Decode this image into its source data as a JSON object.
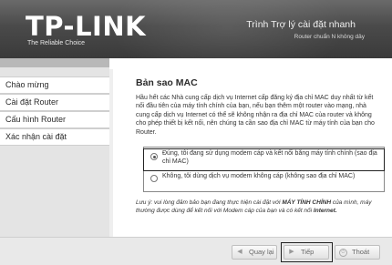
{
  "header": {
    "logo": "TP-LINK",
    "tagline": "The Reliable Choice",
    "title": "Trình Trợ lý cài đặt nhanh",
    "subtitle": "Router chuẩn N không dây"
  },
  "sidebar": {
    "items": [
      {
        "label": "Chào mừng"
      },
      {
        "label": "Cài đặt Router"
      },
      {
        "label": "Cấu hình Router"
      },
      {
        "label": "Xác nhận cài đặt"
      }
    ]
  },
  "main": {
    "title": "Bản sao MAC",
    "description": "Hầu hết các Nhà cung cấp dịch vụ Internet cấp đăng ký địa chỉ MAC duy nhất từ kết nối đầu tiên của máy tính chính của bạn, nếu bạn thêm một router vào mạng, nhà cung cấp dịch vụ Internet có thể sẽ không nhận ra địa chỉ MAC của router và không cho phép thiết bị kết nối, nên chúng ta cần sao địa chỉ MAC từ máy tính của bạn cho Router.",
    "options": [
      {
        "label": "Đúng, tôi đang sử dụng modem cáp và kết nối bằng máy tính chính (sao địa chỉ MAC)",
        "selected": true
      },
      {
        "label": "Không, tôi dùng dịch vụ modem không cáp (không sao địa chỉ MAC)",
        "selected": false
      }
    ],
    "note_prefix": "Lưu ý: vui lòng đảm bảo bạn đang thực hiện cài đặt với ",
    "note_bold1": "MÁY TÍNH CHÍNH",
    "note_mid": " của mình, máy thường được dùng để kết nối với Modem cáp của bạn và có kết nối ",
    "note_bold2": "Internet."
  },
  "footer": {
    "back_label": "Quay lại",
    "next_label": "Tiếp",
    "exit_label": "Thoát"
  }
}
